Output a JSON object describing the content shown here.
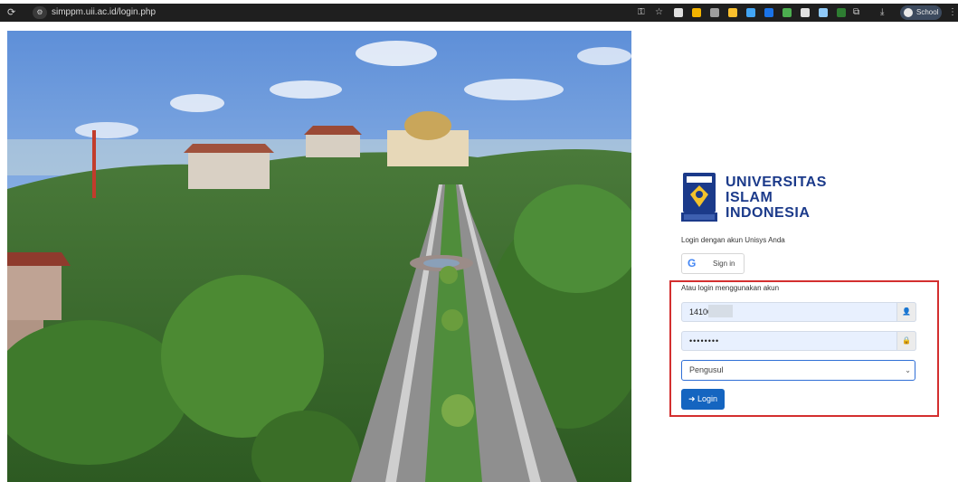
{
  "browser": {
    "url": "simppm.uii.ac.id/login.php",
    "profile_label": "School"
  },
  "brand": {
    "line1": "UNIVERSITAS",
    "line2": "ISLAM",
    "line3": "INDONESIA"
  },
  "login": {
    "hint": "Login dengan akun Unisys Anda",
    "google_label": "Sign in",
    "alt_label": "Atau login menggunakan akun",
    "username_value": "14100",
    "password_value": "••••••••",
    "role_selected": "Pengusul",
    "submit_label": "Login"
  },
  "colors": {
    "brand_blue": "#1b3a8a",
    "highlight_red": "#d32f2f",
    "button_blue": "#1565c0",
    "field_fill": "#e8f0fe"
  },
  "icons": {
    "reload": "reload-icon",
    "site_info": "site-info-icon",
    "user": "user-icon",
    "lock": "lock-icon",
    "google": "google-icon"
  }
}
